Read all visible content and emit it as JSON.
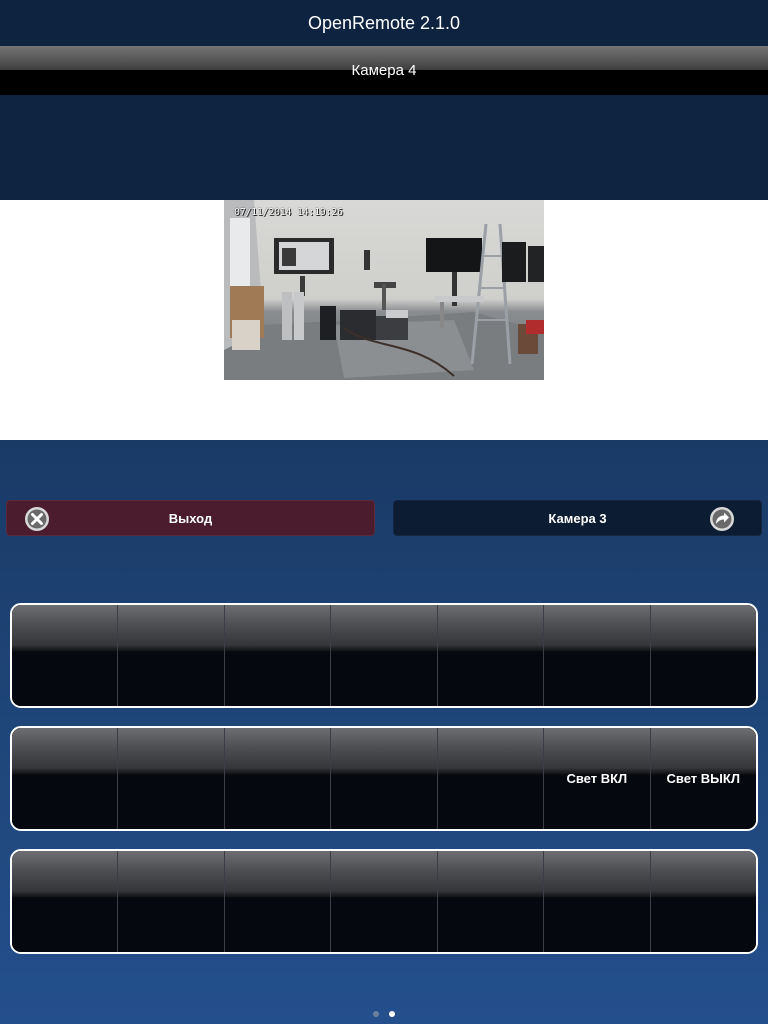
{
  "app": {
    "title": "OpenRemote 2.1.0"
  },
  "navbar": {
    "title": "Камера 4"
  },
  "camera": {
    "overlay_text": "07/11/2014   14:19:26",
    "icon": "camera-feed"
  },
  "buttons": {
    "exit": {
      "label": "Выход",
      "icon": "close-circle-icon",
      "color": "#4a1c2e"
    },
    "next_camera": {
      "label": "Камера 3",
      "icon": "arrow-redo-icon",
      "color": "#0c1c32"
    }
  },
  "panels": [
    {
      "cells": [
        "",
        "",
        "",
        "",
        "",
        "",
        ""
      ]
    },
    {
      "cells": [
        "",
        "",
        "",
        "",
        "",
        "Свет ВКЛ",
        "Свет ВЫКЛ"
      ]
    },
    {
      "cells": [
        "",
        "",
        "",
        "",
        "",
        "",
        ""
      ]
    }
  ],
  "pagination": {
    "total": 2,
    "current": 2
  },
  "colors": {
    "header_bg": "#0d2340",
    "lower_bg": "#1f4679",
    "panel_border": "#ffffff"
  }
}
